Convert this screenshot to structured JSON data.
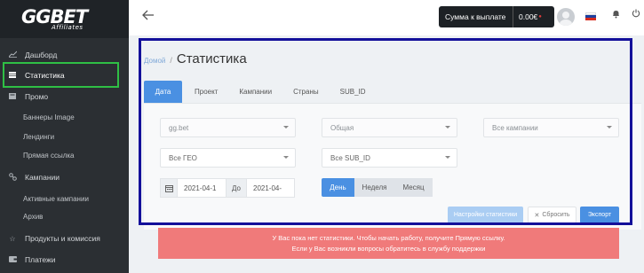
{
  "brand": {
    "logo": "GGBET",
    "logo_sub": "Affiliates"
  },
  "sidebar": {
    "items": [
      {
        "label": "Дашборд",
        "icon": "chart-line-icon"
      },
      {
        "label": "Статистика",
        "icon": "table-icon",
        "active": true
      },
      {
        "label": "Промо",
        "icon": "promo-icon"
      },
      {
        "label": "Баннеры Image"
      },
      {
        "label": "Лендинги"
      },
      {
        "label": "Прямая ссылка"
      },
      {
        "label": "Кампании",
        "icon": "link-icon"
      },
      {
        "label": "Активные кампании"
      },
      {
        "label": "Архив"
      },
      {
        "label": "Продукты и комиссия",
        "icon": "star-icon"
      },
      {
        "label": "Платежи",
        "icon": "wallet-icon"
      }
    ]
  },
  "topbar": {
    "payout_label": "Сумма к выплате",
    "payout_value": "0.00€",
    "language": "ru",
    "colors": {
      "flag": [
        "#ffffff",
        "#1c3f9e",
        "#d52b1e"
      ]
    }
  },
  "breadcrumb": {
    "home": "Домой",
    "separator": "/",
    "current": "Статистика"
  },
  "tabs": [
    "Дата",
    "Проект",
    "Кампании",
    "Страны",
    "SUB_ID"
  ],
  "filters": {
    "project": "gg.bet",
    "type": "Общая",
    "campaigns": "Все кампании",
    "geo": "Все ГЕО",
    "sub_id": "Все SUB_ID",
    "date_from": "2021-04-1",
    "date_to_label": "До",
    "date_to": "2021-04-",
    "periods": [
      "День",
      "Неделя",
      "Месяц"
    ]
  },
  "buttons": {
    "settings": "Настройки статистики",
    "reset": "Сбросить",
    "export": "Экспорт"
  },
  "alert": {
    "line1": "У Вас пока нет статистики. Чтобы начать работу, получите Прямую ссылку.",
    "line2": "Если у Вас возникли вопросы обратитесь в службу поддержки"
  },
  "colors": {
    "accent": "#4a90e2",
    "sidebar": "#2b2f33",
    "alert": "#f07a7a",
    "highlight_green": "#2fbf45",
    "highlight_blue": "#13109a"
  }
}
